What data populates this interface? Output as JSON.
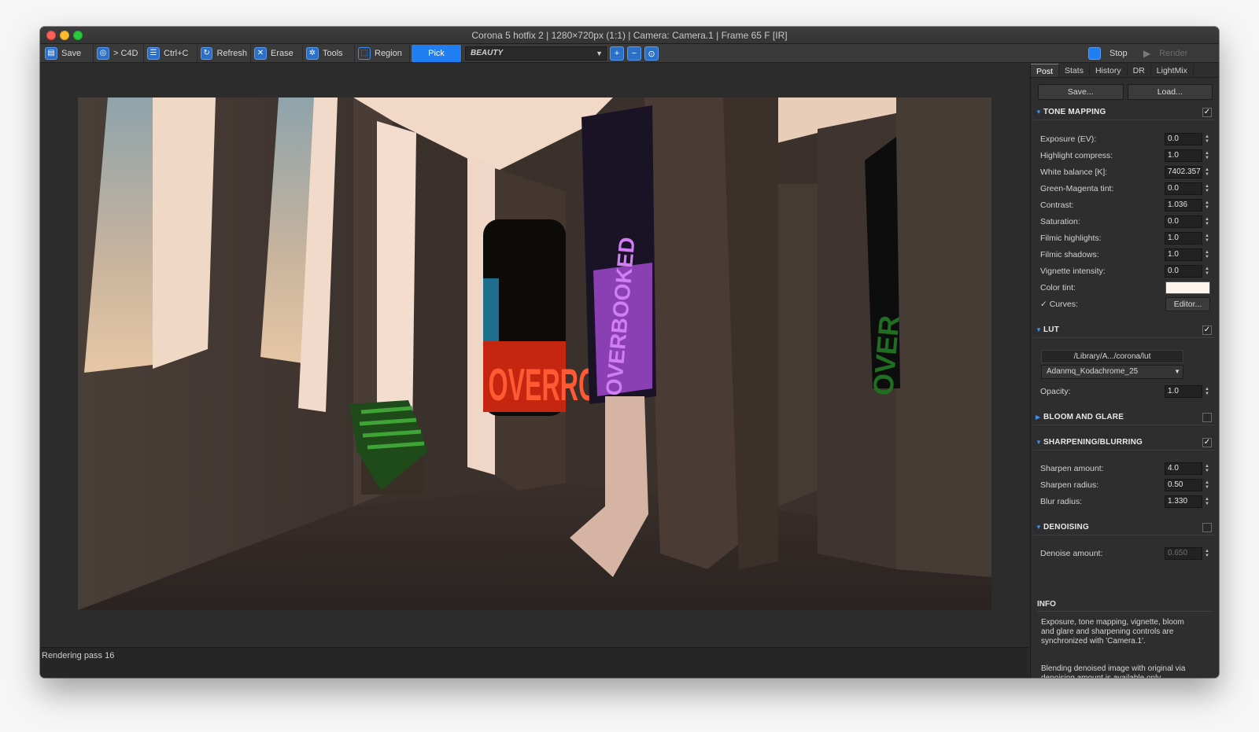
{
  "window": {
    "title": "Corona 5 hotfix 2 | 1280×720px (1:1) | Camera: Camera.1 | Frame 65 F [IR]"
  },
  "toolbar": {
    "save_label": "Save",
    "c4d_label": "> C4D",
    "copy_label": "Ctrl+C",
    "refresh_label": "Refresh",
    "erase_label": "Erase",
    "tools_label": "Tools",
    "region_label": "Region",
    "pick_label": "Pick",
    "channel_value": "BEAUTY",
    "stop_label": "Stop",
    "render_label": "Render"
  },
  "status": {
    "text": "Rendering pass 16"
  },
  "panel": {
    "tabs": [
      "Post",
      "Stats",
      "History",
      "DR",
      "LightMix"
    ],
    "active_tab": "Post",
    "save_label": "Save...",
    "load_label": "Load...",
    "tone_mapping": {
      "title": "TONE MAPPING",
      "enabled": true,
      "fields": [
        {
          "label": "Exposure (EV):",
          "value": "0.0"
        },
        {
          "label": "Highlight compress:",
          "value": "1.0"
        },
        {
          "label": "White balance [K]:",
          "value": "7402.357"
        },
        {
          "label": "Green-Magenta tint:",
          "value": "0.0"
        },
        {
          "label": "Contrast:",
          "value": "1.036"
        },
        {
          "label": "Saturation:",
          "value": "0.0"
        },
        {
          "label": "Filmic highlights:",
          "value": "1.0"
        },
        {
          "label": "Filmic shadows:",
          "value": "1.0"
        },
        {
          "label": "Vignette intensity:",
          "value": "0.0"
        }
      ],
      "color_tint_label": "Color tint:",
      "color_tint_value": "#fff4ee",
      "curves_label": "Curves:",
      "curves_enabled": true,
      "editor_label": "Editor..."
    },
    "lut": {
      "title": "LUT",
      "enabled": true,
      "path": "/Library/A.../corona/lut",
      "selected": "Adanmq_Kodachrome_25",
      "opacity_label": "Opacity:",
      "opacity_value": "1.0"
    },
    "bloom": {
      "title": "BLOOM AND GLARE",
      "enabled": false
    },
    "sharpening": {
      "title": "SHARPENING/BLURRING",
      "enabled": true,
      "fields": [
        {
          "label": "Sharpen amount:",
          "value": "4.0"
        },
        {
          "label": "Sharpen radius:",
          "value": "0.50"
        },
        {
          "label": "Blur radius:",
          "value": "1.330"
        }
      ]
    },
    "denoising": {
      "title": "DENOISING",
      "enabled": false,
      "amount_label": "Denoise amount:",
      "amount_value": "0.650"
    },
    "info": {
      "title": "INFO",
      "text1": "Exposure, tone mapping, vignette, bloom and glare and sharpening controls are synchronized with 'Camera.1'.",
      "text2": "Blending denoised image with original via denoising amount is available only"
    }
  },
  "render": {
    "poster_left_text": "OVERRO",
    "poster_center_text": "OVERBOOKED",
    "poster_right_text": "OVER"
  }
}
